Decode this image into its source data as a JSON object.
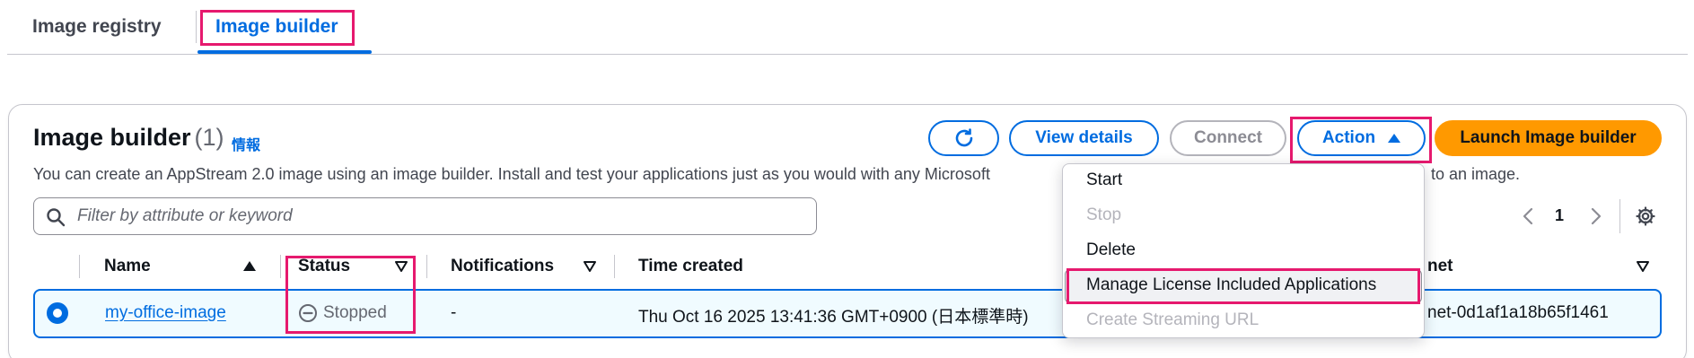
{
  "tabs": [
    {
      "label": "Image registry"
    },
    {
      "label": "Image builder"
    }
  ],
  "header": {
    "title": "Image builder",
    "count": "(1)",
    "info": "情報",
    "description": "You can create an AppStream 2.0 image using an image builder. Install and test your applications just as you would with any Microsoft",
    "description_tail": "to an image."
  },
  "toolbar": {
    "view_details": "View details",
    "connect": "Connect",
    "action": "Action",
    "launch": "Launch Image builder"
  },
  "filter": {
    "placeholder": "Filter by attribute or keyword"
  },
  "pagination": {
    "page": "1"
  },
  "table": {
    "columns": {
      "name": "Name",
      "status": "Status",
      "notifications": "Notifications",
      "time_created": "Time created",
      "subnet": "net"
    },
    "rows": [
      {
        "name": "my-office-image",
        "status": "Stopped",
        "notifications": "-",
        "time_created": "Thu Oct 16 2025 13:41:36 GMT+0900 (日本標準時)",
        "subnet": "net-0d1af1a18b65f1461"
      }
    ]
  },
  "action_menu": {
    "items": [
      {
        "label": "Start",
        "disabled": false
      },
      {
        "label": "Stop",
        "disabled": true
      },
      {
        "label": "Delete",
        "disabled": false
      },
      {
        "label": "Manage License Included Applications",
        "disabled": false
      },
      {
        "label": "Create Streaming URL",
        "disabled": true
      }
    ]
  },
  "colors": {
    "accent": "#006ce0",
    "highlight": "#e6196e",
    "primary_button": "#ff9900"
  }
}
